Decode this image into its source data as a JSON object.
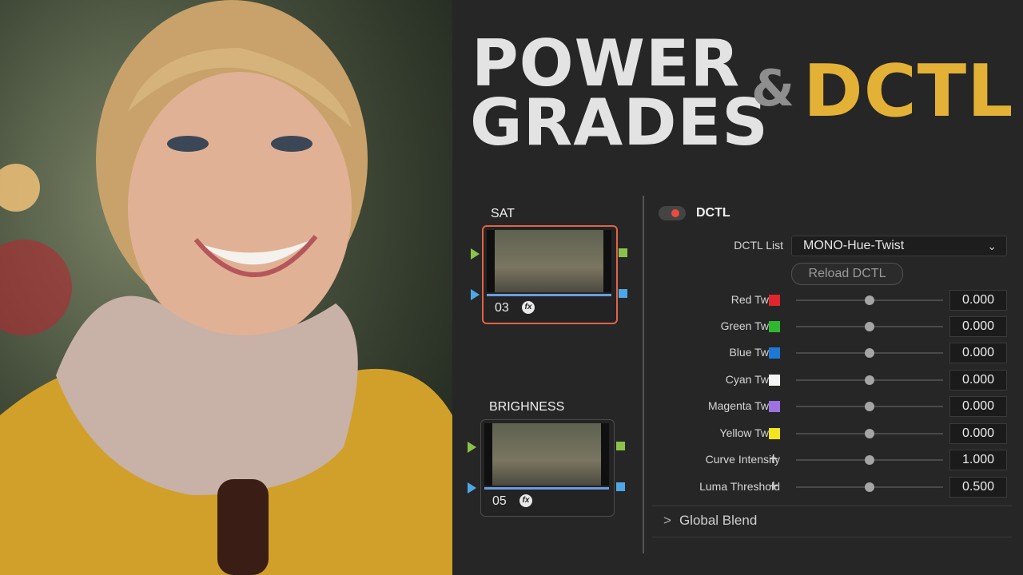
{
  "title": {
    "line1": "POWER",
    "line2": "GRADES",
    "ampersand": "&",
    "accent": "DCTL",
    "accent_color": "#e3b135"
  },
  "nodes": [
    {
      "label": "SAT",
      "number": "03",
      "fx": "fx",
      "selected": true
    },
    {
      "label": "BRIGHNESS",
      "number": "05",
      "fx": "fx",
      "selected": false
    }
  ],
  "panel": {
    "header": "DCTL",
    "toggle_on": true,
    "dctl_list_label": "DCTL List",
    "dctl_list_value": "MONO-Hue-Twist",
    "reload_label": "Reload DCTL",
    "params": [
      {
        "label": "Red Twist",
        "swatch": "#e0262c",
        "value": "0.000"
      },
      {
        "label": "Green Twist",
        "swatch": "#2fb82f",
        "value": "0.000"
      },
      {
        "label": "Blue Twist",
        "swatch": "#1e78d6",
        "value": "0.000"
      },
      {
        "label": "Cyan Twist",
        "swatch": "#f4f4f4",
        "value": "0.000"
      },
      {
        "label": "Magenta Twist",
        "swatch": "#9c72e0",
        "value": "0.000"
      },
      {
        "label": "Yellow Twist",
        "swatch": "#f2e41e",
        "value": "0.000"
      },
      {
        "label": "Curve Intensity",
        "swatch": "plus-icon",
        "value": "1.000"
      },
      {
        "label": "Luma Threshold",
        "swatch": "plus-icon",
        "value": "0.500"
      }
    ],
    "global_blend": "Global Blend"
  }
}
